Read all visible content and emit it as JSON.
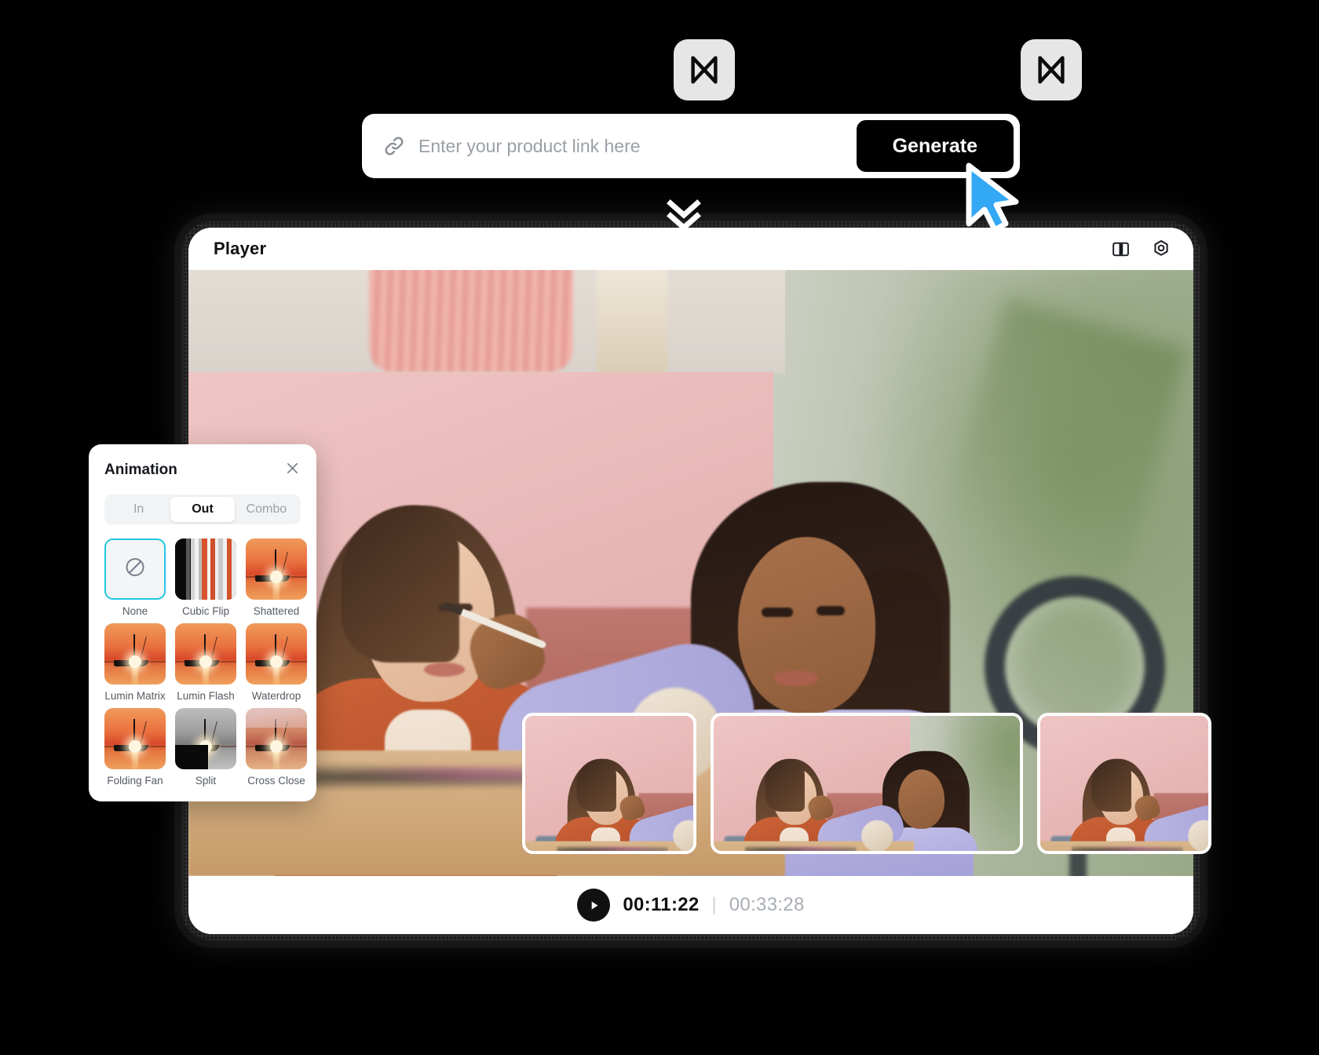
{
  "prompt_bar": {
    "icon": "link-icon",
    "placeholder": "Enter your product link here",
    "value": "",
    "generate_label": "Generate"
  },
  "chevrons": {
    "icon": "double-chevron-down-icon"
  },
  "cursor": {
    "icon": "arrow-cursor",
    "color": "#33A8F5"
  },
  "player": {
    "title": "Player",
    "header_icons": [
      {
        "name": "split-view-icon"
      },
      {
        "name": "settings-gear-icon"
      }
    ],
    "playback": {
      "play_icon": "play-icon",
      "current_time": "00:11:22",
      "separator": "|",
      "total_time": "00:33:28"
    },
    "timeline": {
      "clip_count": 3,
      "transition_icon": "transition-bowtie-icon",
      "transitions": 2
    }
  },
  "animation_panel": {
    "title": "Animation",
    "close_icon": "close-icon",
    "tabs": [
      {
        "label": "In",
        "active": false
      },
      {
        "label": "Out",
        "active": true
      },
      {
        "label": "Combo",
        "active": false
      }
    ],
    "selected_effect": "None",
    "selection_color": "#22C8E0",
    "effects": [
      {
        "label": "None",
        "thumb": "none",
        "selected": true
      },
      {
        "label": "Cubic Flip",
        "thumb": "cubic",
        "selected": false
      },
      {
        "label": "Shattered",
        "thumb": "sunset",
        "selected": false
      },
      {
        "label": "Lumin Matrix",
        "thumb": "sunset",
        "selected": false
      },
      {
        "label": "Lumin Flash",
        "thumb": "sunset",
        "selected": false
      },
      {
        "label": "Waterdrop",
        "thumb": "sunset",
        "selected": false
      },
      {
        "label": "Folding Fan",
        "thumb": "sunset",
        "selected": false
      },
      {
        "label": "Split",
        "thumb": "gray",
        "selected": false
      },
      {
        "label": "Cross Close",
        "thumb": "pale",
        "selected": false
      }
    ]
  },
  "theme": {
    "background": "#000000",
    "surface": "#FFFFFF",
    "accent_black": "#000000",
    "cursor_blue": "#33A8F5",
    "select_cyan": "#22C8E0"
  }
}
